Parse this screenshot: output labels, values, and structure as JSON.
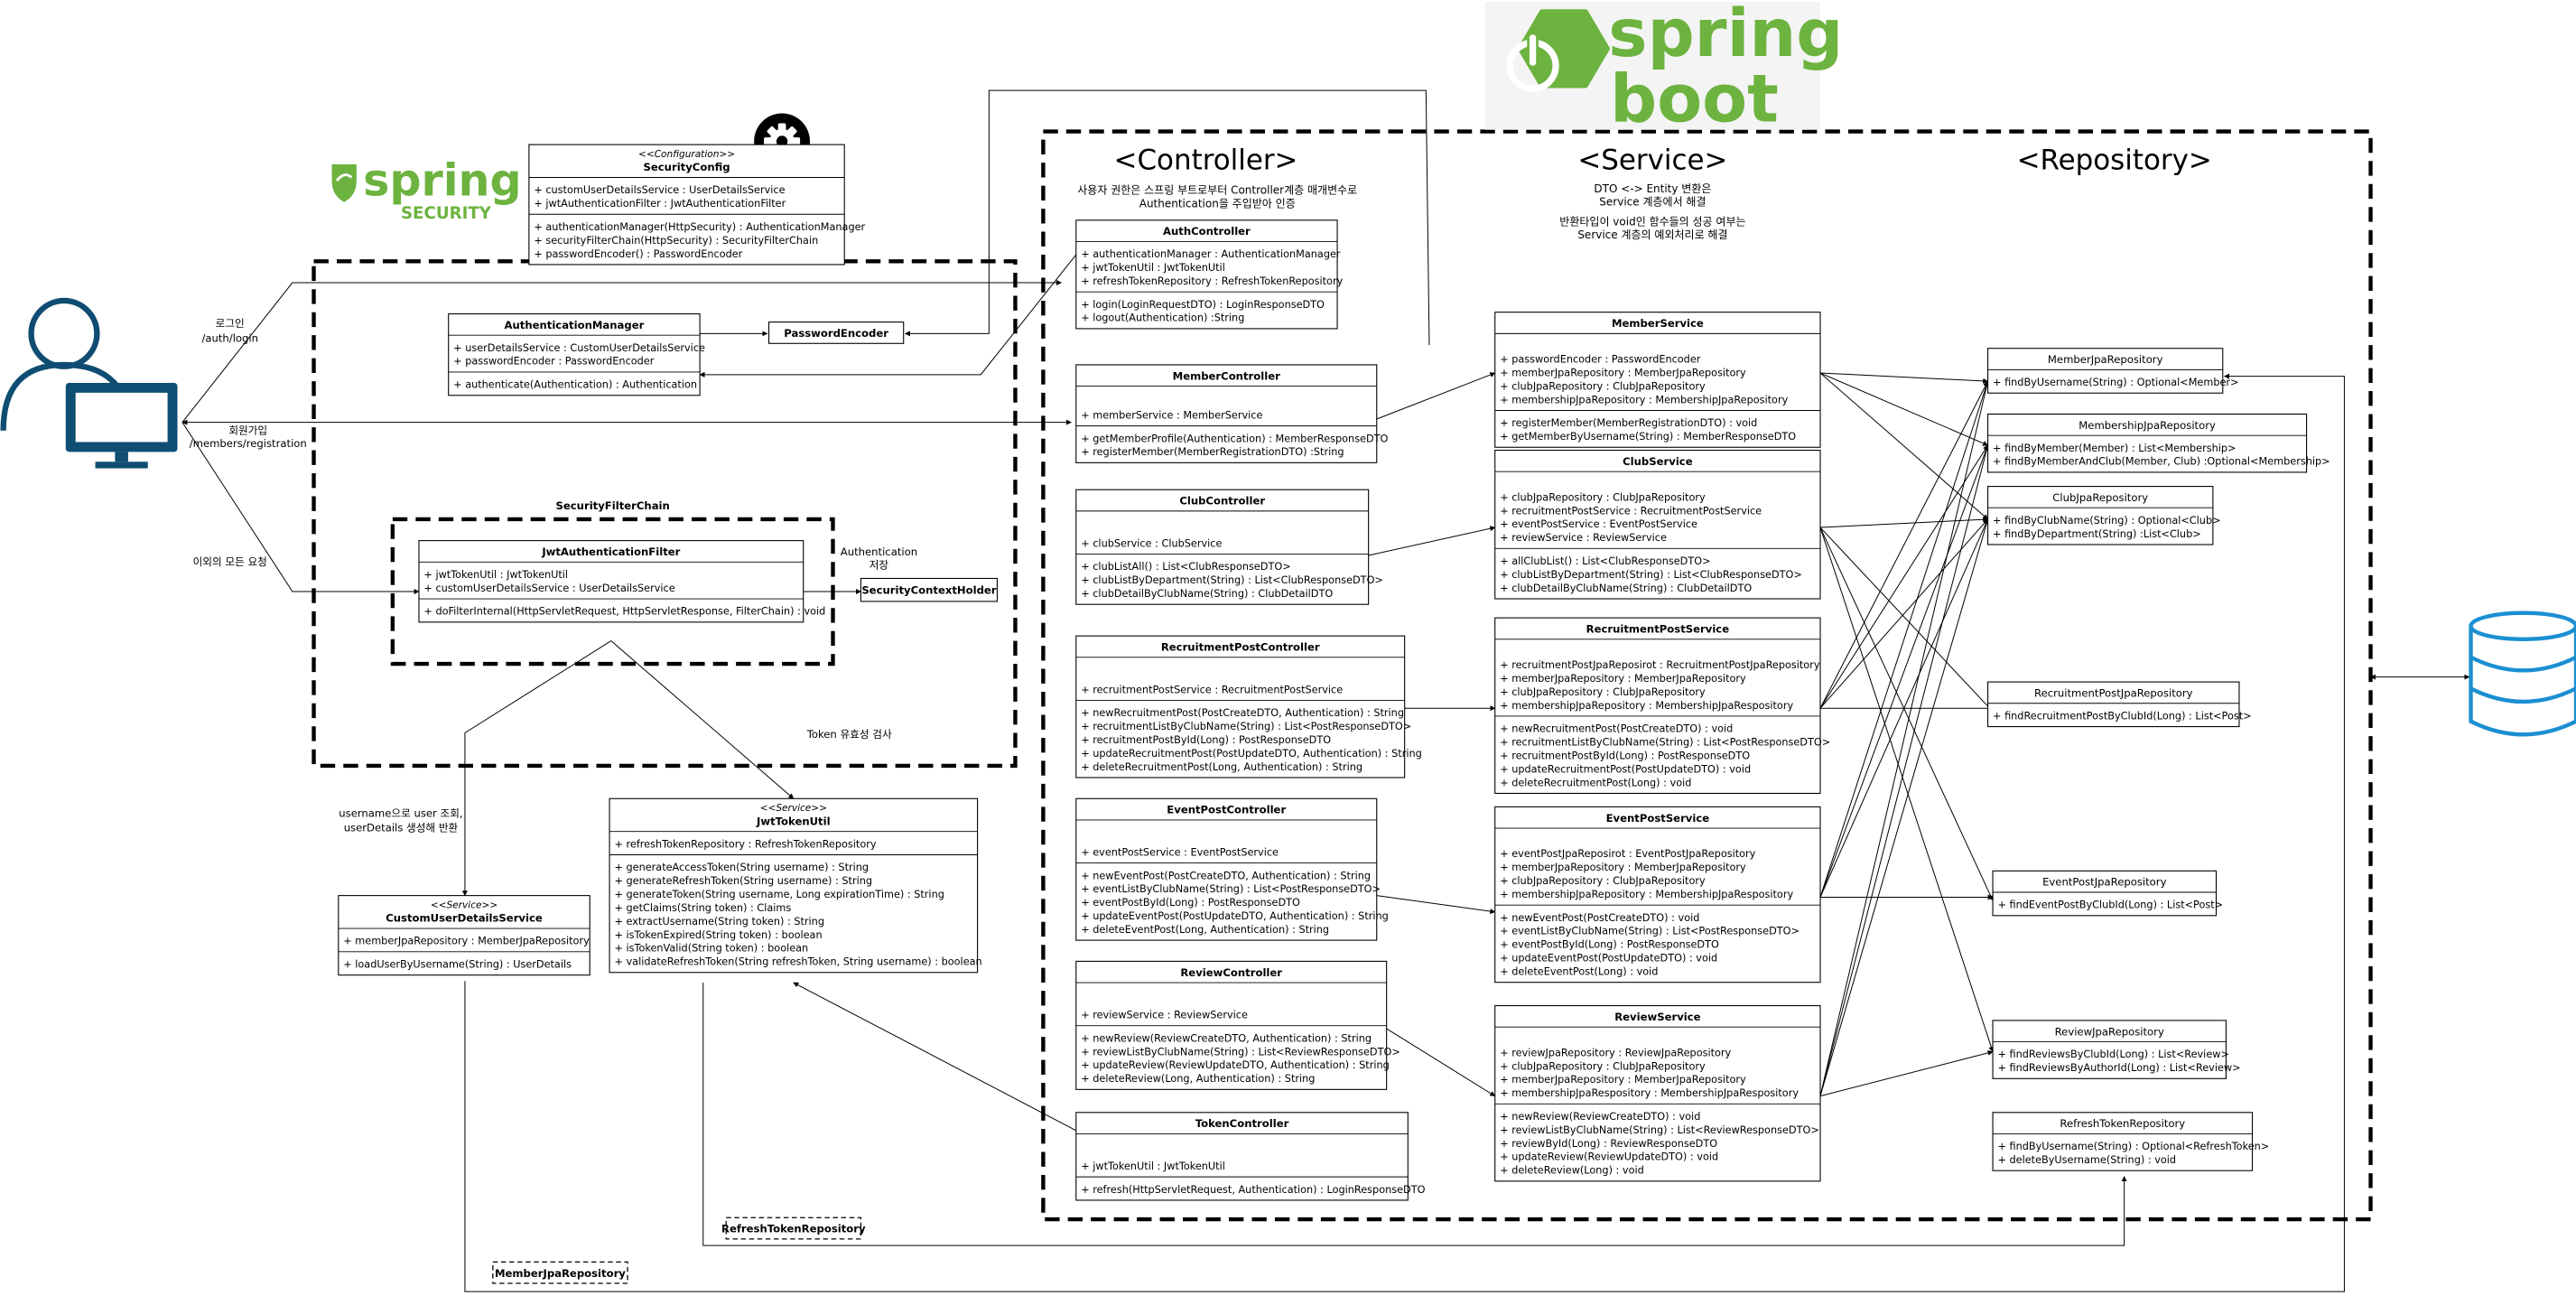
{
  "logos": {
    "spring_security": {
      "word": "spring",
      "sub": "SECURITY"
    },
    "spring_boot": {
      "word1": "spring",
      "word2": "boot"
    }
  },
  "headings": {
    "controller": "<Controller>",
    "service": "<Service>",
    "repository": "<Repository>"
  },
  "notes": {
    "controller_1": "사용자 권한은 스프링 부트로부터 Controller계층 매개변수로",
    "controller_2": "Authentication을 주입받아 인증",
    "service_1": "DTO <-> Entity 변환은",
    "service_2": "Service 계층에서 해결",
    "service_3": "반환타입이 void인 함수들의 성공 여부는",
    "service_4": "Service 계층의 예외처리로 해결"
  },
  "labels": {
    "login_1": "로그인",
    "login_2": "/auth/login",
    "register_1": "회원가입",
    "register_2": "/members/registration",
    "other": "이외의 모든 요청",
    "filter_chain": "SecurityFilterChain",
    "auth_save_1": "Authentication",
    "auth_save_2": "저장",
    "token_check": "Token 유효성 검사",
    "lookup_1": "username으로 user 조회,",
    "lookup_2": "userDetails 생성해 반환"
  },
  "security": {
    "config": {
      "stereotype": "<<Configuration>>",
      "name": "SecurityConfig",
      "fields": [
        "+ customUserDetailsService : UserDetailsService",
        "+ jwtAuthenticationFilter : JwtAuthenticationFilter"
      ],
      "methods": [
        "+ authenticationManager(HttpSecurity) : AuthenticationManager",
        "+ securityFilterChain(HttpSecurity) : SecurityFilterChain",
        "+ passwordEncoder() : PasswordEncoder"
      ]
    },
    "auth_manager": {
      "name": "AuthenticationManager",
      "fields": [
        "+ userDetailsService : CustomUserDetailsService",
        "+ passwordEncoder : PasswordEncoder"
      ],
      "methods": [
        "+ authenticate(Authentication) : Authentication"
      ]
    },
    "password_encoder": {
      "name": "PasswordEncoder"
    },
    "jwt_filter": {
      "name": "JwtAuthenticationFilter",
      "fields": [
        "+ jwtTokenUtil : JwtTokenUtil",
        "+ customUserDetailsService : UserDetailsService"
      ],
      "methods": [
        "+ doFilterInternal(HttpServletRequest, HttpServletResponse, FilterChain) : void"
      ]
    },
    "context_holder": {
      "name": "SecurityContextHolder"
    },
    "user_details_service": {
      "stereotype": "<<Service>>",
      "name": "CustomUserDetailsService",
      "fields": [
        "+ memberJpaRepository : MemberJpaRepository"
      ],
      "methods": [
        "+ loadUserByUsername(String) : UserDetails"
      ]
    },
    "jwt_util": {
      "stereotype": "<<Service>>",
      "name": "JwtTokenUtil",
      "fields": [
        "+ refreshTokenRepository : RefreshTokenRepository"
      ],
      "methods": [
        "+ generateAccessToken(String username) : String",
        "+ generateRefreshToken(String username) : String",
        "+ generateToken(String username, Long expirationTime) : String",
        "+ getClaims(String token) : Claims",
        "+ extractUsername(String token) : String",
        "+ isTokenExpired(String token) : boolean",
        "+ isTokenValid(String token) : boolean",
        "+ validateRefreshToken(String refreshToken, String username) : boolean"
      ]
    },
    "refresh_repo_ref": "RefreshTokenRepository",
    "member_repo_ref": "MemberJpaRepository"
  },
  "controllers": [
    {
      "name": "AuthController",
      "fields": [
        "+ authenticationManager : AuthenticationManager",
        "+ jwtTokenUtil : JwtTokenUtil",
        "+ refreshTokenRepository : RefreshTokenRepository"
      ],
      "methods": [
        "+ login(LoginRequestDTO) : LoginResponseDTO",
        "+ logout(Authentication) :String"
      ]
    },
    {
      "name": "MemberController",
      "fields": [
        "+ memberService : MemberService"
      ],
      "methods": [
        "+ getMemberProfile(Authentication) : MemberResponseDTO",
        "+ registerMember(MemberRegistrationDTO) :String"
      ]
    },
    {
      "name": "ClubController",
      "fields": [
        "+ clubService : ClubService"
      ],
      "methods": [
        "+ clubListAll() : List<ClubResponseDTO>",
        "+ clubListByDepartment(String) : List<ClubResponseDTO>",
        "+ clubDetailByClubName(String) : ClubDetailDTO"
      ]
    },
    {
      "name": "RecruitmentPostController",
      "fields": [
        "+ recruitmentPostService : RecruitmentPostService"
      ],
      "methods": [
        "+ newRecruitmentPost(PostCreateDTO, Authentication) : String",
        "+ recruitmentListByClubName(String) : List<PostResponseDTO>",
        "+ recruitmentPostById(Long) : PostResponseDTO",
        "+ updateRecruitmentPost(PostUpdateDTO, Authentication) : String",
        "+ deleteRecruitmentPost(Long, Authentication) : String"
      ]
    },
    {
      "name": "EventPostController",
      "fields": [
        "+ eventPostService : EventPostService"
      ],
      "methods": [
        "+ newEventPost(PostCreateDTO, Authentication) : String",
        "+ eventListByClubName(String) : List<PostResponseDTO>",
        "+ eventPostById(Long) : PostResponseDTO",
        "+ updateEventPost(PostUpdateDTO, Authentication) : String",
        "+ deleteEventPost(Long, Authentication) : String"
      ]
    },
    {
      "name": "ReviewController",
      "fields": [
        "+ reviewService : ReviewService"
      ],
      "methods": [
        "+ newReview(ReviewCreateDTO, Authentication) : String",
        "+ reviewListByClubName(String) : List<ReviewResponseDTO>",
        "+ updateReview(ReviewUpdateDTO, Authentication) : String",
        "+ deleteReview(Long, Authentication) : String"
      ]
    },
    {
      "name": "TokenController",
      "fields": [
        "+ jwtTokenUtil : JwtTokenUtil"
      ],
      "methods": [
        "+ refresh(HttpServletRequest, Authentication) : LoginResponseDTO"
      ]
    }
  ],
  "services": [
    {
      "name": "MemberService",
      "fields": [
        "+ passwordEncoder : PasswordEncoder",
        "+ memberJpaRepository : MemberJpaRepository",
        "+ clubJpaRepository : ClubJpaRepository",
        "+ membershipJpaRepository : MembershipJpaRepository"
      ],
      "methods": [
        "+ registerMember(MemberRegistrationDTO) : void",
        "+ getMemberByUsername(String) : MemberResponseDTO"
      ]
    },
    {
      "name": "ClubService",
      "fields": [
        "+ clubJpaRepository : ClubJpaRepository",
        "+ recruitmentPostService : RecruitmentPostService",
        "+ eventPostService : EventPostService",
        "+ reviewService : ReviewService"
      ],
      "methods": [
        "+ allClubList() : List<ClubResponseDTO>",
        "+ clubListByDepartment(String) : List<ClubResponseDTO>",
        "+ clubDetailByClubName(String) : ClubDetailDTO"
      ]
    },
    {
      "name": "RecruitmentPostService",
      "fields": [
        "+ recruitmentPostJpaReposirot : RecruitmentPostJpaRepository",
        "+ memberJpaRepository : MemberJpaRepository",
        "+ clubJpaRepository : ClubJpaRepository",
        "+ membershipJpaRepository : MembershipJpaRespository"
      ],
      "methods": [
        "+ newRecruitmentPost(PostCreateDTO) : void",
        "+ recruitmentListByClubName(String) : List<PostResponseDTO>",
        "+ recruitmentPostById(Long) : PostResponseDTO",
        "+ updateRecruitmentPost(PostUpdateDTO) : void",
        "+ deleteRecruitmentPost(Long) : void"
      ]
    },
    {
      "name": "EventPostService",
      "fields": [
        "+ eventPostJpaReposirot : EventPostJpaRepository",
        "+ memberJpaRepository : MemberJpaRepository",
        "+ clubJpaRepository : ClubJpaRepository",
        "+ membershipJpaRepository : MembershipJpaRespository"
      ],
      "methods": [
        "+ newEventPost(PostCreateDTO) : void",
        "+ eventListByClubName(String) : List<PostResponseDTO>",
        "+ eventPostById(Long) : PostResponseDTO",
        "+ updateEventPost(PostUpdateDTO) : void",
        "+ deleteEventPost(Long) : void"
      ]
    },
    {
      "name": "ReviewService",
      "fields": [
        "+ reviewJpaRepository : ReviewJpaRepository",
        "+ clubJpaRepository : ClubJpaRepository",
        "+ memberJpaRepository : MemberJpaRepository",
        "+ membershipJpaRespository : MembershipJpaRespository"
      ],
      "methods": [
        "+ newReview(ReviewCreateDTO) : void",
        "+ reviewListByClubName(String) : List<ReviewResponseDTO>",
        "+ reviewById(Long) : ReviewResponseDTO",
        "+ updateReview(ReviewUpdateDTO) : void",
        "+ deleteReview(Long) : void"
      ]
    }
  ],
  "repositories": [
    {
      "name": "MemberJpaRepository",
      "methods": [
        "+ findByUsername(String) : Optional<Member>"
      ]
    },
    {
      "name": "MembershipJpaRepository",
      "methods": [
        "+ findByMember(Member) : List<Membership>",
        "+ findByMemberAndClub(Member, Club) :Optional<Membership>"
      ]
    },
    {
      "name": "ClubJpaRepository",
      "methods": [
        "+ findByClubName(String) : Optional<Club>",
        "+ findByDepartment(String) :List<Club>"
      ]
    },
    {
      "name": "RecruitmentPostJpaRepository",
      "methods": [
        "+ findRecruitmentPostByClubId(Long) : List<Post>"
      ]
    },
    {
      "name": "EventPostJpaRepository",
      "methods": [
        "+ findEventPostByClubId(Long) : List<Post>"
      ]
    },
    {
      "name": "ReviewJpaRepository",
      "methods": [
        "+ findReviewsByClubId(Long) : List<Review>",
        "+ findReviewsByAuthorId(Long) : List<Review>"
      ]
    },
    {
      "name": "RefreshTokenRepository",
      "methods": [
        "+ findByUsername(String) : Optional<RefreshToken>",
        "+ deleteByUsername(String) : void"
      ]
    }
  ],
  "colors": {
    "spring_green": "#6db33f",
    "user_blue": "#0f4d72",
    "database_blue": "#1b8fd2"
  },
  "icons": [
    "user-computer-icon",
    "gear-icon",
    "spring-power-icon",
    "shield-icon",
    "database-icon"
  ]
}
